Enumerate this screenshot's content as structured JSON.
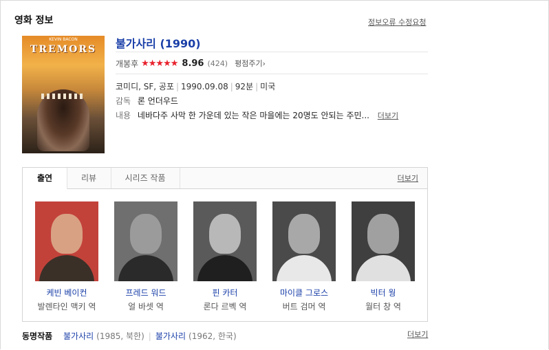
{
  "section": {
    "title": "영화 정보",
    "report_link": "정보오류 수정요청"
  },
  "poster": {
    "title_text": "TREMORS",
    "top_text": "KEVIN BACON"
  },
  "movie": {
    "title": "불가사리 (1990)"
  },
  "rating": {
    "label": "개봉후",
    "stars": "★★★★★",
    "score": "8.96",
    "count": "(424)",
    "rate_button": "평점주기›"
  },
  "info": {
    "genre": "코미디, SF, 공포",
    "release": "1990.09.08",
    "runtime": "92분",
    "country": "미국"
  },
  "director": {
    "label": "감독",
    "name": "론 언더우드"
  },
  "plot": {
    "label": "내용",
    "text": "네바다주 사막 한 가운데 있는 작은 마을에는 20명도 안되는 주민...",
    "more": "더보기"
  },
  "tabs": [
    {
      "label": "출연"
    },
    {
      "label": "리뷰"
    },
    {
      "label": "시리즈 작품"
    }
  ],
  "tabs_more": "더보기",
  "cast": [
    {
      "name": "케빈 베이컨",
      "role": "발렌타인 맥키 역",
      "bg": "#c2423a",
      "skin": "#d9a184",
      "cloth": "#3a3028"
    },
    {
      "name": "프레드 워드",
      "role": "얼 바셋 역",
      "bg": "#6f6f6f",
      "skin": "#9b9b9b",
      "cloth": "#2a2a2a"
    },
    {
      "name": "핀 카터",
      "role": "론다 르벡 역",
      "bg": "#5a5a5a",
      "skin": "#b8b8b8",
      "cloth": "#1f1f1f"
    },
    {
      "name": "마이클 그로스",
      "role": "버트 검머 역",
      "bg": "#4a4a4a",
      "skin": "#a8a8a8",
      "cloth": "#e8e8e8"
    },
    {
      "name": "빅터 웡",
      "role": "월터 창 역",
      "bg": "#3f3f3f",
      "skin": "#a0a0a0",
      "cloth": "#e0e0e0"
    }
  ],
  "same_title": {
    "label": "동명작품",
    "items": [
      {
        "title": "불가사리",
        "meta": "(1985, 북한)"
      },
      {
        "title": "불가사리",
        "meta": "(1962, 한국)"
      }
    ],
    "more": "더보기"
  }
}
